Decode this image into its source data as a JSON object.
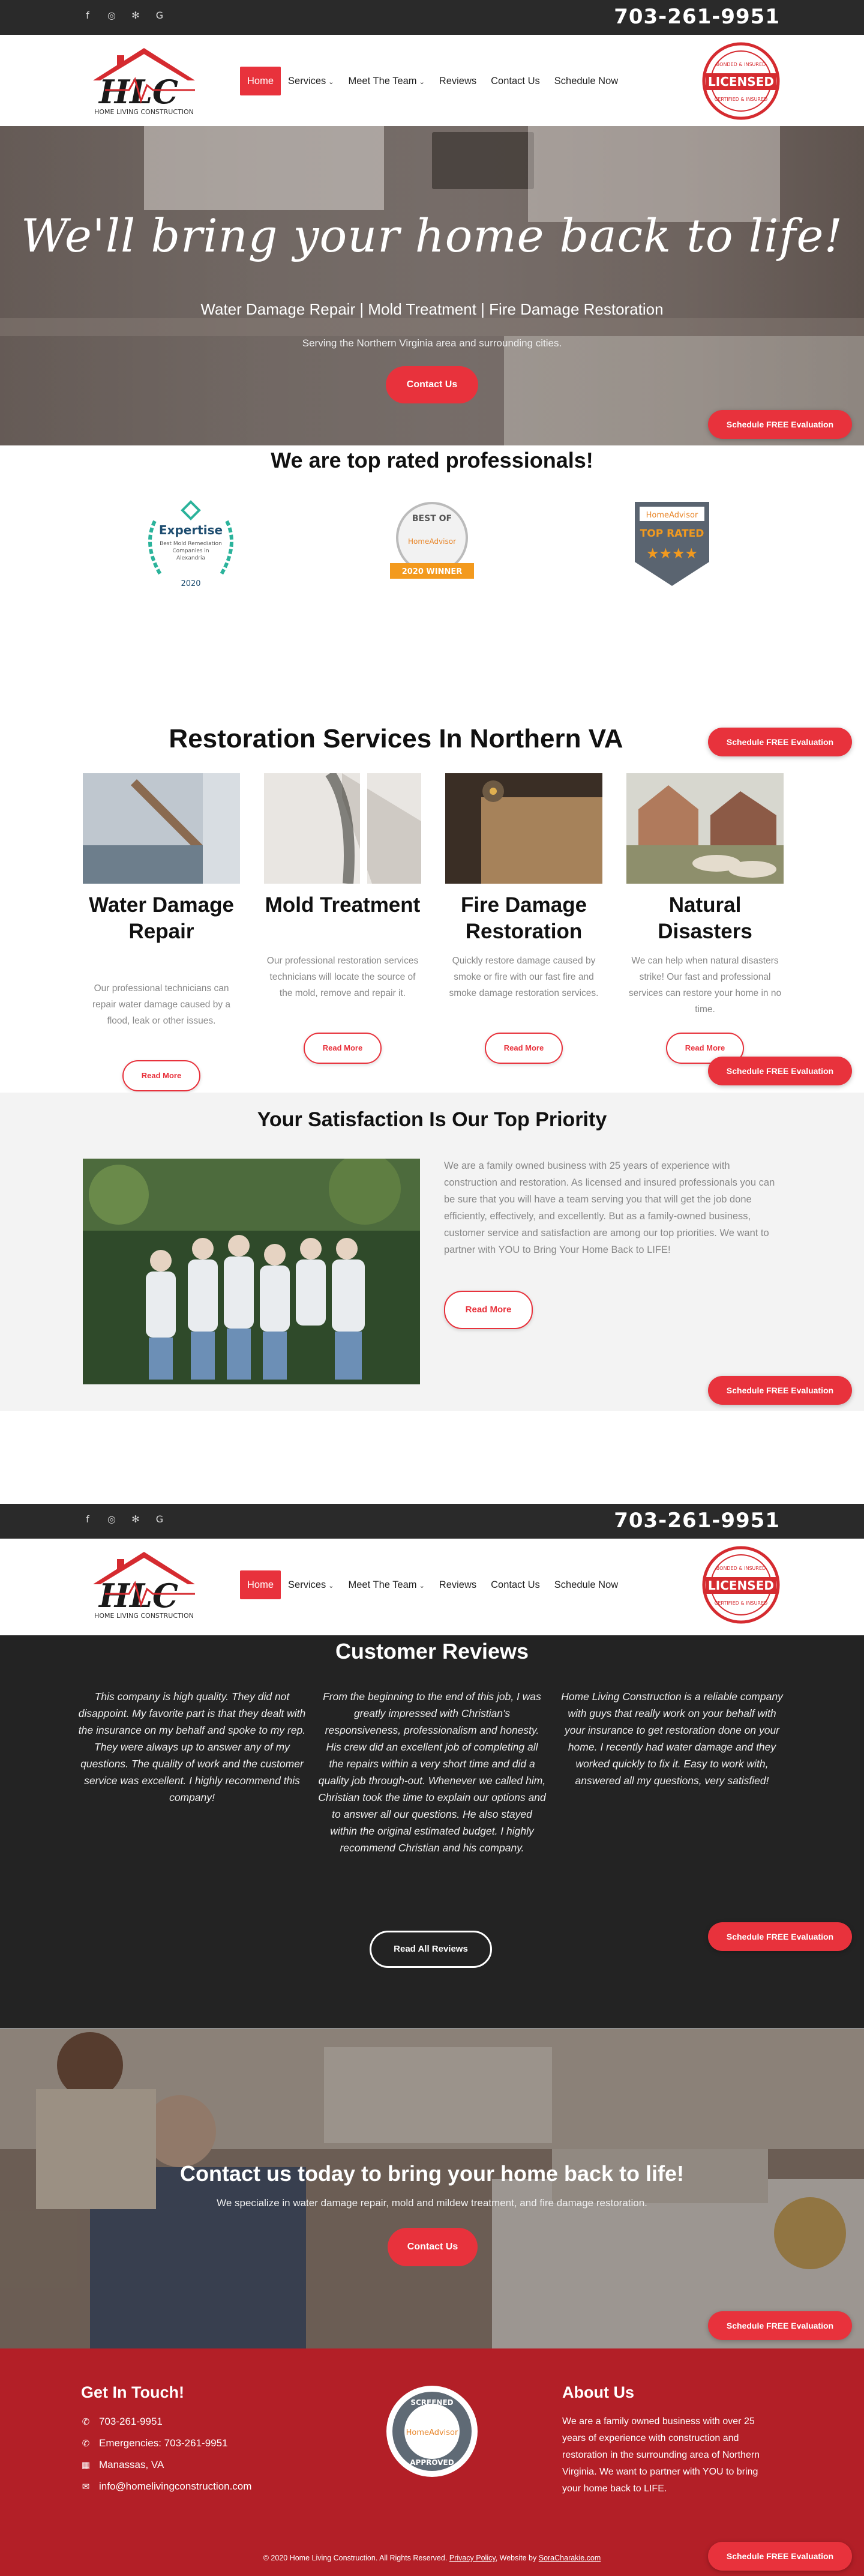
{
  "phone": "703-261-9951",
  "brand": {
    "logo_text": "HLC",
    "logo_sub": "HOME LIVING CONSTRUCTION",
    "badge_text": "LICENSED",
    "badge_ring_top": "BONDED & INSURED",
    "badge_ring_bottom": "CERTIFIED & INSURED"
  },
  "nav": {
    "home": "Home",
    "services": "Services",
    "meet": "Meet The Team",
    "reviews": "Reviews",
    "contact": "Contact Us",
    "schedule": "Schedule Now"
  },
  "hero": {
    "headline": "We'll bring your home back to life!",
    "subtitle": "Water Damage Repair | Mold Treatment | Fire Damage Restoration",
    "area": "Serving the Northern Virginia area and surrounding cities.",
    "cta": "Contact Us"
  },
  "schedule_button": "Schedule FREE Evaluation",
  "rated": {
    "title": "We are top rated professionals!",
    "expertise": {
      "name": "Expertise",
      "line1": "Best Mold Remediation",
      "line2": "Companies in",
      "line3": "Alexandria",
      "year": "2020"
    },
    "bestof": {
      "top": "BEST OF",
      "brand": "HomeAdvisor",
      "ribbon": "2020 WINNER"
    },
    "toprated": {
      "brand": "HomeAdvisor",
      "label": "TOP RATED"
    }
  },
  "services": {
    "title": "Restoration Services In Northern VA",
    "items": [
      {
        "title": "Water Damage Repair",
        "text": "Our professional technicians can repair water damage caused by a flood, leak or other issues.",
        "button": "Read More"
      },
      {
        "title": "Mold Treatment",
        "text": "Our professional restoration services technicians will locate the source of the mold, remove and repair it.",
        "button": "Read More"
      },
      {
        "title": "Fire Damage Restoration",
        "text": "Quickly restore damage caused by smoke or fire with our fast fire and smoke damage restoration services.",
        "button": "Read More"
      },
      {
        "title": "Natural Disasters",
        "text": "We can help when natural disasters strike! Our fast and professional services can restore your home in no time.",
        "button": "Read More"
      }
    ]
  },
  "satisfaction": {
    "title": "Your Satisfaction Is Our Top Priority",
    "text": "We are a family owned business with 25 years of experience with construction and restoration. As licensed and insured professionals you can be sure that you will have a team serving you that will get the job done efficiently, effectively, and excellently. But as a family-owned business, customer service and satisfaction are among our top priorities. We want to partner with YOU to Bring Your Home Back to LIFE!",
    "button": "Read More"
  },
  "reviews": {
    "title": "Customer Reviews",
    "items": [
      "This company is high quality. They did not disappoint. My favorite part is that they dealt with the insurance on my behalf and spoke to my rep. They were always up to answer any of my questions. The quality of work and the customer service was excellent. I highly recommend this company!",
      "From the beginning to the end of this job, I was greatly impressed with Christian's responsiveness, professionalism and honesty. His crew did an excellent job of completing all the repairs within a very short time and did a quality job through-out. Whenever we called him, Christian took the time to explain our options and to answer all our questions. He also stayed within the original estimated budget. I highly recommend Christian and his company.",
      "Home Living Construction is a reliable company with guys that really work on your behalf with your insurance to get restoration done on your home. I recently had water damage and they worked quickly to fix it. Easy to work with, answered all my questions, very satisfied!"
    ],
    "button": "Read All Reviews"
  },
  "contact_band": {
    "title": "Contact us today to bring your home back to life!",
    "text": "We specialize in water damage repair, mold and mildew treatment, and fire damage restoration.",
    "button": "Contact Us"
  },
  "footer": {
    "touch_title": "Get In Touch!",
    "phone": "703-261-9951",
    "emergencies": "Emergencies: 703-261-9951",
    "location": "Manassas, VA",
    "email": "info@homelivingconstruction.com",
    "screened": {
      "top": "SCREENED",
      "brand": "HomeAdvisor",
      "bottom": "APPROVED"
    },
    "about_title": "About Us",
    "about_text": "We are a family owned business with over 25 years of experience with construction and restoration in the surrounding area of Northern Virginia. We want to partner with YOU to bring your home back to LIFE.",
    "copyright": "© 2020 Home Living Construction. All Rights Reserved.",
    "privacy": "Privacy Policy",
    "website_by": "Website by",
    "credit": "SoraCharakie.com"
  },
  "colors": {
    "accent": "#e8323c",
    "dark": "#232323",
    "footer": "#b31f27"
  },
  "icons": [
    "facebook-icon",
    "instagram-icon",
    "yelp-icon",
    "google-icon",
    "phone-icon",
    "map-pin-icon",
    "email-icon",
    "chevron-down-icon"
  ]
}
